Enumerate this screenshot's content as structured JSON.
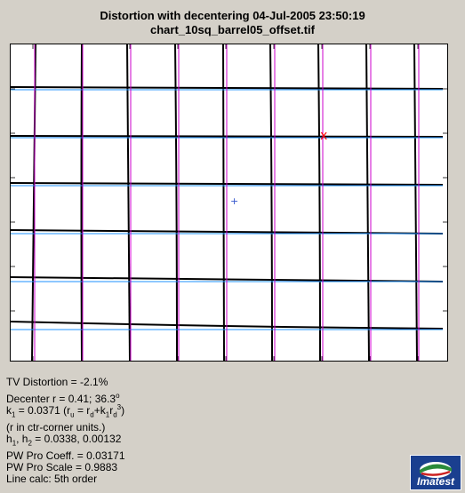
{
  "header": {
    "title_line1": "Distortion with decentering  04-Jul-2005 23:50:19",
    "title_line2": "chart_10sq_barrel05_offset.tif"
  },
  "plot": {
    "markers": {
      "center_cross": "+",
      "x_mark": "x"
    },
    "colors": {
      "measured_line": "#000000",
      "fit_horizontal": "#1e90ff",
      "fit_vertical": "#cc00cc",
      "x_mark": "#ff0000",
      "center": "#3355cc"
    }
  },
  "info": {
    "tv_distortion": "TV Distortion = -2.1%",
    "decenter_prefix": "Decenter r = 0.41;  36.3",
    "decenter_deg": "o",
    "k1_k": "k",
    "k1_sub": "1",
    "k1_value": " = 0.0371  (r",
    "k1_u": "u",
    "k1_mid": " = r",
    "k1_d": "d",
    "k1_plus": "+k",
    "k1_sub2": "1",
    "k1_r": "r",
    "k1_d2": "d",
    "k1_sq": "3",
    "k1_close": ")",
    "units_note": "(r in ctr-corner units.)",
    "h_prefix": "h",
    "h1_sub": "1",
    "h_mid": ", h",
    "h2_sub": "2",
    "h_value": " = 0.0338, 0.00132",
    "pw_coeff": "PW Pro Coeff. = 0.03171",
    "pw_scale": "PW Pro Scale = 0.9883",
    "line_calc": "Line calc: 5th order"
  },
  "logo": {
    "text": "Imatest"
  }
}
